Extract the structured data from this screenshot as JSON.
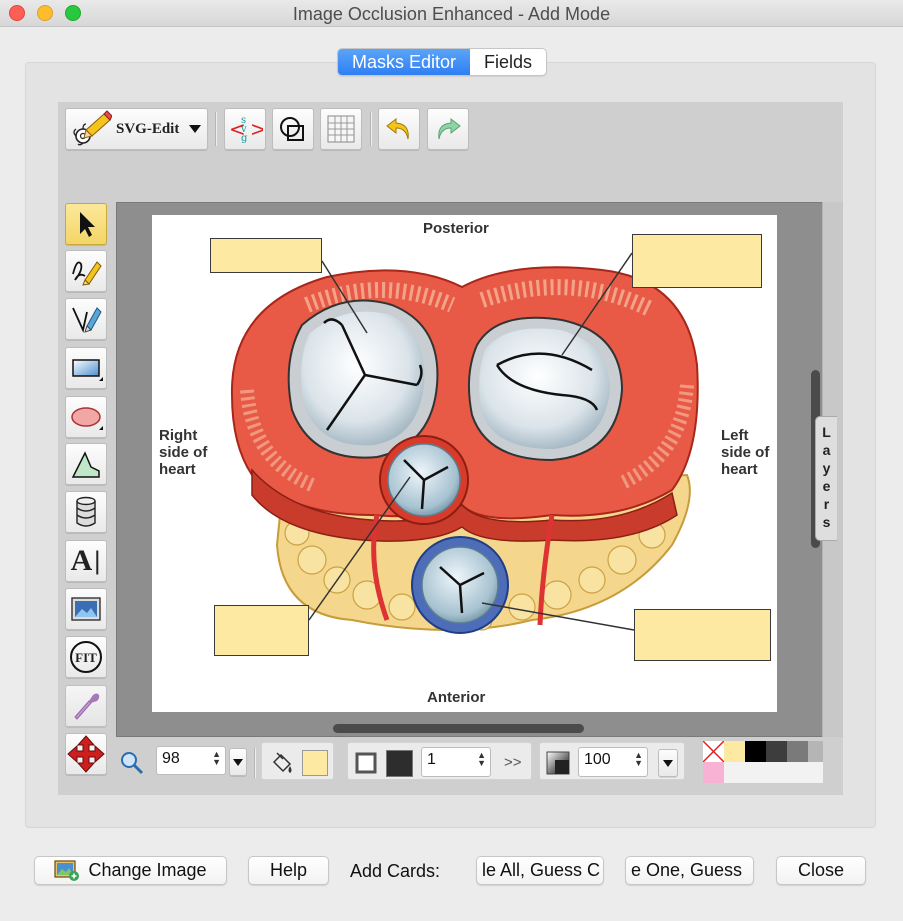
{
  "window": {
    "title": "Image Occlusion Enhanced - Add Mode"
  },
  "tabs": [
    {
      "label": "Masks Editor",
      "active": true
    },
    {
      "label": "Fields",
      "active": false
    }
  ],
  "toolbar": {
    "mode_button_label": "SVG-Edit",
    "svg_icon_text": "svg"
  },
  "left_tools": [
    "select-tool-icon",
    "freehand-pencil-icon",
    "path-pen-icon",
    "rectangle-tool-icon",
    "ellipse-tool-icon",
    "polygon-tool-icon",
    "database-shape-icon",
    "text-tool-icon",
    "image-tool-icon",
    "fit-zoom-icon",
    "eyedropper-icon",
    "pan-move-icon"
  ],
  "fit_label": "FIT",
  "text_tool_label": "A",
  "canvas": {
    "labels": {
      "top": "Posterior",
      "bottom": "Anterior",
      "left": [
        "Right",
        "side of",
        "heart"
      ],
      "right": [
        "Left",
        "side of",
        "heart"
      ]
    },
    "layers_label": "Layers"
  },
  "bottom_toolbar": {
    "zoom_value": "98",
    "stroke_width": "1",
    "opacity_value": "100",
    "expand_glyph": ">>"
  },
  "colors": {
    "mask_fill": "#fde9a1",
    "accent": "#2f7ff4",
    "palette": [
      "none",
      "#fde9a1",
      "#000000",
      "#3d3d3d",
      "#7a7a7a",
      "#b5b5b5",
      "#f8b2d4"
    ]
  },
  "footer": {
    "change_image": "Change Image",
    "help": "Help",
    "add_cards_label": "Add Cards:",
    "hide_all": "le All, Guess C",
    "hide_one": "e One, Guess",
    "close": "Close"
  }
}
